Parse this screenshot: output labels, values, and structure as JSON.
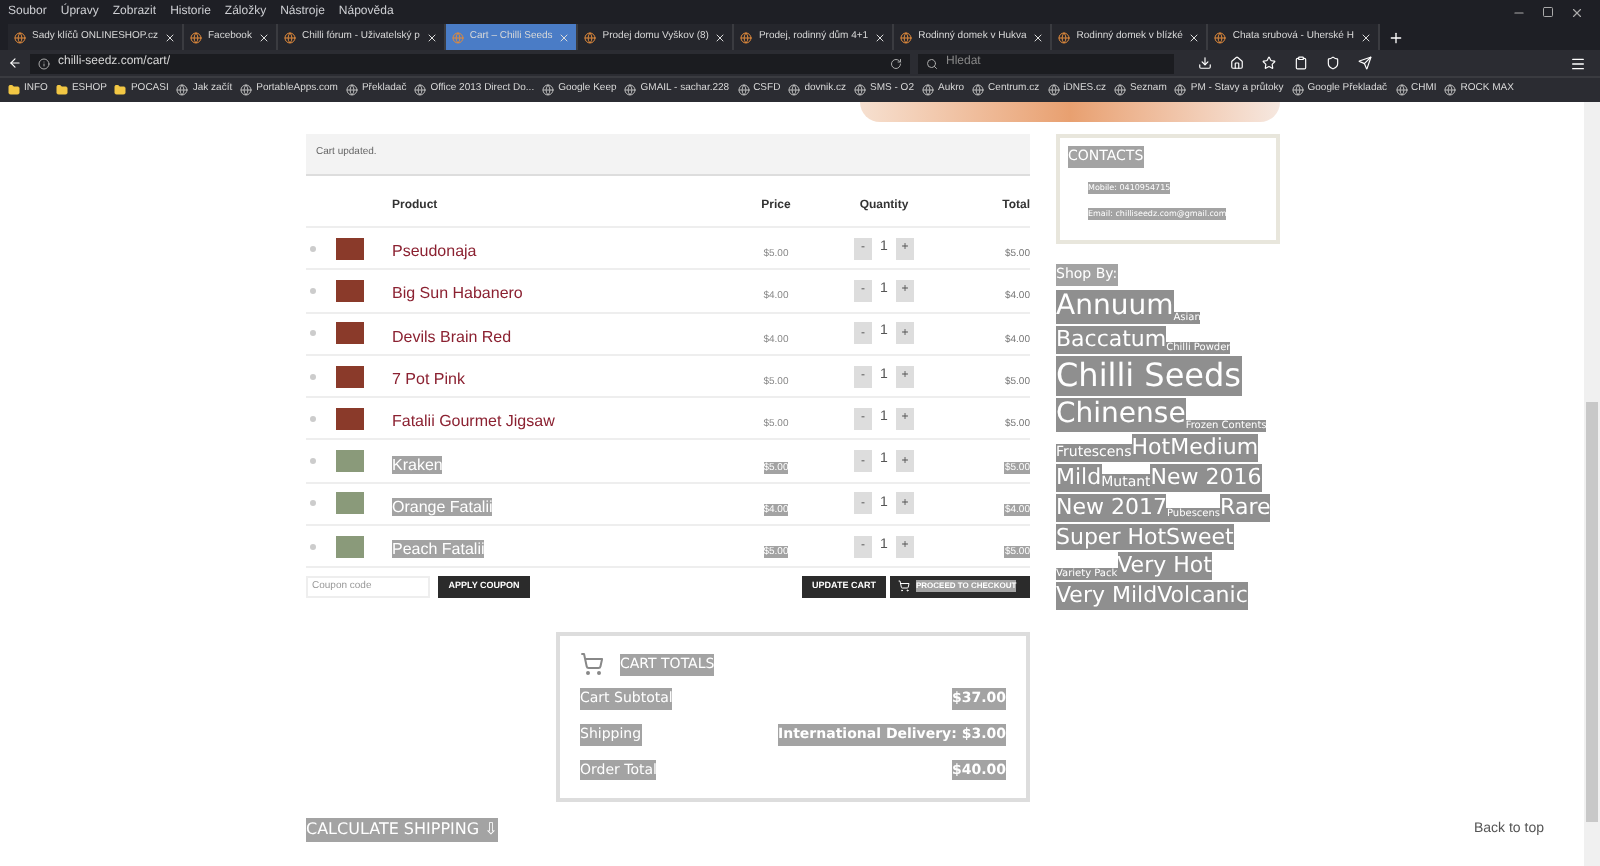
{
  "menu_bar": [
    "Soubor",
    "Úpravy",
    "Zobrazit",
    "Historie",
    "Záložky",
    "Nástroje",
    "Nápověda"
  ],
  "tabs": [
    {
      "label": "Sady klíčů ONLINESHOP.cz",
      "selected": false
    },
    {
      "label": "Facebook",
      "selected": false
    },
    {
      "label": "Chilli fórum - Uživatelský p",
      "selected": false
    },
    {
      "label": "Cart – Chilli Seeds",
      "selected": true
    },
    {
      "label": "Prodej domu Vyškov (8)",
      "selected": false
    },
    {
      "label": "Prodej, rodinný dům 4+1",
      "selected": false
    },
    {
      "label": "Rodinný domek v Hukva",
      "selected": false
    },
    {
      "label": "Rodinný domek v blízké",
      "selected": false
    },
    {
      "label": "Chata srubová - Uherské H",
      "selected": false
    }
  ],
  "address_bar": {
    "url": "chilli-seedz.com/cart/",
    "search_placeholder": "Hledat"
  },
  "bookmarks": [
    {
      "label": "INFO",
      "kind": "folder"
    },
    {
      "label": "ESHOP",
      "kind": "folder"
    },
    {
      "label": "POCASI",
      "kind": "folder"
    },
    {
      "label": "Jak začít",
      "kind": "site"
    },
    {
      "label": "PortableApps.com",
      "kind": "site"
    },
    {
      "label": "Překladač",
      "kind": "site"
    },
    {
      "label": "Office 2013 Direct Do...",
      "kind": "site"
    },
    {
      "label": "Google Keep",
      "kind": "site"
    },
    {
      "label": "GMAIL - sachar.228",
      "kind": "site"
    },
    {
      "label": "CSFD",
      "kind": "site"
    },
    {
      "label": "dovnik.cz",
      "kind": "site"
    },
    {
      "label": "SMS - O2",
      "kind": "site"
    },
    {
      "label": "Aukro",
      "kind": "site"
    },
    {
      "label": "Centrum.cz",
      "kind": "site"
    },
    {
      "label": "iDNES.cz",
      "kind": "site"
    },
    {
      "label": "Seznam",
      "kind": "site"
    },
    {
      "label": "PM - Stavy a průtoky",
      "kind": "site"
    },
    {
      "label": "Google Překladač",
      "kind": "site"
    },
    {
      "label": "CHMI",
      "kind": "site"
    },
    {
      "label": "ROCK MAX",
      "kind": "site"
    }
  ],
  "notice": "Cart updated.",
  "table": {
    "columns": [
      "Product",
      "Price",
      "Quantity",
      "Total"
    ],
    "rows": [
      {
        "name": "Pseudonaja",
        "price": "$5.00",
        "minus": "-",
        "quantity": "1",
        "plus": "+",
        "total": "$5.00",
        "highlighted": false
      },
      {
        "name": "Big Sun Habanero",
        "price": "$4.00",
        "minus": "-",
        "quantity": "1",
        "plus": "+",
        "total": "$4.00",
        "highlighted": false
      },
      {
        "name": "Devils Brain Red",
        "price": "$4.00",
        "minus": "-",
        "quantity": "1",
        "plus": "+",
        "total": "$4.00",
        "highlighted": false
      },
      {
        "name": "7 Pot Pink",
        "price": "$5.00",
        "minus": "-",
        "quantity": "1",
        "plus": "+",
        "total": "$5.00",
        "highlighted": false
      },
      {
        "name": "Fatalii Gourmet Jigsaw",
        "price": "$5.00",
        "minus": "-",
        "quantity": "1",
        "plus": "+",
        "total": "$5.00",
        "highlighted": false
      },
      {
        "name": "Kraken",
        "price": "$5.00",
        "minus": "-",
        "quantity": "1",
        "plus": "+",
        "total": "$5.00",
        "highlighted": true
      },
      {
        "name": "Orange Fatalii",
        "price": "$4.00",
        "minus": "-",
        "quantity": "1",
        "plus": "+",
        "total": "$4.00",
        "highlighted": true
      },
      {
        "name": "Peach Fatalii",
        "price": "$5.00",
        "minus": "-",
        "quantity": "1",
        "plus": "+",
        "total": "$5.00",
        "highlighted": true
      }
    ]
  },
  "coupon": {
    "placeholder": "Coupon code",
    "apply_button": "APPLY COUPON"
  },
  "update_button": "UPDATE CART",
  "checkout_button": "PROCEED TO CHECKOUT",
  "cart_totals": {
    "title": "CART TOTALS",
    "rows": [
      {
        "label": "Cart Subtotal",
        "value": "$37.00"
      },
      {
        "label": "Shipping",
        "value": "International Delivery: $3.00"
      },
      {
        "label": "Order Total",
        "value": "$40.00"
      }
    ]
  },
  "calculate_shipping": "CALCULATE SHIPPING ⇩",
  "back_to_top": "Back to top",
  "contacts": {
    "title": "CONTACTS",
    "lines": [
      "Mobile: 0410954715",
      "Email: chilliseedz.com@gmail.com"
    ]
  },
  "shop_by": {
    "title": "Shop By:",
    "tags": [
      {
        "label": "Annuum",
        "kind": "lg"
      },
      {
        "label": "Asian",
        "kind": "xs"
      },
      {
        "label": "Baccatum",
        "kind": "md"
      },
      {
        "label": "Chilli Powder",
        "kind": "xs"
      },
      {
        "label": "Chilli Seeds",
        "kind": "xl"
      },
      {
        "label": "Chinense",
        "kind": "lg"
      },
      {
        "label": "Frozen Contents",
        "kind": "xs"
      },
      {
        "label": "Frutescens",
        "kind": "sm"
      },
      {
        "label": "Hot",
        "kind": "md"
      },
      {
        "label": "Medium",
        "kind": "md"
      },
      {
        "label": "Mild",
        "kind": "md"
      },
      {
        "label": "Mutant",
        "kind": "sm"
      },
      {
        "label": "New 2016",
        "kind": "md"
      },
      {
        "label": "New 2017",
        "kind": "md"
      },
      {
        "label": "Pubescens",
        "kind": "xs"
      },
      {
        "label": "Rare",
        "kind": "md"
      },
      {
        "label": "Super Hot",
        "kind": "md"
      },
      {
        "label": "Sweet",
        "kind": "md"
      },
      {
        "label": "Variety Pack",
        "kind": "xs"
      },
      {
        "label": "Very Hot",
        "kind": "md"
      },
      {
        "label": "Very Mild",
        "kind": "md"
      },
      {
        "label": "Volcanic",
        "kind": "md"
      }
    ]
  }
}
